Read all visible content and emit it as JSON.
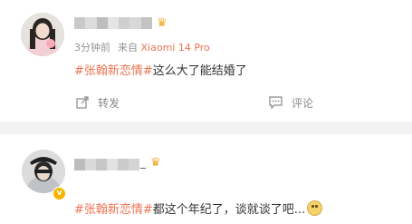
{
  "post1": {
    "time": "3分钟前",
    "source_prefix": "来自",
    "device": "Xiaomi 14 Pro",
    "topic": "#张翰新恋情#",
    "text": "这么大了能结婚了",
    "repost_label": "转发",
    "comment_label": "评论"
  },
  "post2": {
    "name_suffix": "_",
    "topic": "#张翰新恋情#",
    "text": "都这个年纪了，谈就谈了吧..."
  },
  "colors": {
    "accent": "#eb7350",
    "meta": "#939393",
    "background": "#f2f2f2"
  },
  "icons": {
    "crown": "crown-icon",
    "verified": "verified-badge-icon",
    "repost": "repost-icon",
    "comment": "comment-icon",
    "emoji": "thinking-emoji-icon"
  }
}
